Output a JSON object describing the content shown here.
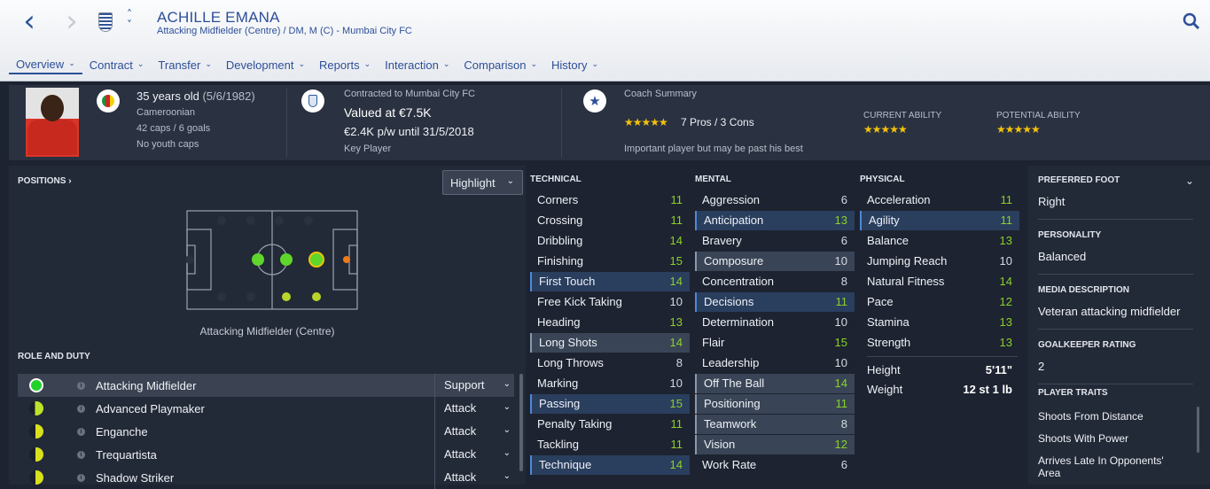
{
  "app": {
    "player_name": "ACHILLE EMANA",
    "player_subtitle": "Attacking Midfielder (Centre) / DM, M (C) - Mumbai City FC"
  },
  "tabs": [
    {
      "label": "Overview"
    },
    {
      "label": "Contract"
    },
    {
      "label": "Transfer"
    },
    {
      "label": "Development"
    },
    {
      "label": "Reports"
    },
    {
      "label": "Interaction"
    },
    {
      "label": "Comparison"
    },
    {
      "label": "History"
    }
  ],
  "header": {
    "age": "35 years old",
    "dob": "(5/6/1982)",
    "nationality": "Cameroonian",
    "caps": "42 caps / 6 goals",
    "youth_caps": "No youth caps",
    "contract_title": "Contracted to Mumbai City FC",
    "valued": "Valued at €7.5K",
    "wage": "€2.4K p/w until 31/5/2018",
    "status": "Key Player",
    "coach_title": "Coach Summary",
    "pros_cons": "7 Pros / 3 Cons",
    "coach_comment": "Important player but may be past his best",
    "ca_label": "CURRENT ABILITY",
    "pa_label": "POTENTIAL ABILITY",
    "ca_stars": 5,
    "pa_stars": 5,
    "star_color": "#f4c20d"
  },
  "positions": {
    "label": "POSITIONS",
    "highlight": "Highlight",
    "selected": "Attacking Midfielder (Centre)"
  },
  "roles": {
    "label": "ROLE AND DUTY",
    "items": [
      {
        "name": "Attacking Midfielder",
        "duty": "Support",
        "color": "#22d12a"
      },
      {
        "name": "Advanced Playmaker",
        "duty": "Attack",
        "color": "#bfe22a"
      },
      {
        "name": "Enganche",
        "duty": "Attack",
        "color": "#d8e01e"
      },
      {
        "name": "Trequartista",
        "duty": "Attack",
        "color": "#d8e01e"
      },
      {
        "name": "Shadow Striker",
        "duty": "Attack",
        "color": "#d8e01e"
      }
    ]
  },
  "technical": {
    "label": "TECHNICAL",
    "items": [
      {
        "name": "Corners",
        "value": "11"
      },
      {
        "name": "Crossing",
        "value": "11"
      },
      {
        "name": "Dribbling",
        "value": "14"
      },
      {
        "name": "Finishing",
        "value": "15"
      },
      {
        "name": "First Touch",
        "value": "14"
      },
      {
        "name": "Free Kick Taking",
        "value": "10"
      },
      {
        "name": "Heading",
        "value": "13"
      },
      {
        "name": "Long Shots",
        "value": "14"
      },
      {
        "name": "Long Throws",
        "value": "8"
      },
      {
        "name": "Marking",
        "value": "10"
      },
      {
        "name": "Passing",
        "value": "15"
      },
      {
        "name": "Penalty Taking",
        "value": "11"
      },
      {
        "name": "Tackling",
        "value": "11"
      },
      {
        "name": "Technique",
        "value": "14"
      }
    ]
  },
  "mental": {
    "label": "MENTAL",
    "items": [
      {
        "name": "Aggression",
        "value": "6"
      },
      {
        "name": "Anticipation",
        "value": "13"
      },
      {
        "name": "Bravery",
        "value": "6"
      },
      {
        "name": "Composure",
        "value": "10"
      },
      {
        "name": "Concentration",
        "value": "8"
      },
      {
        "name": "Decisions",
        "value": "11"
      },
      {
        "name": "Determination",
        "value": "10"
      },
      {
        "name": "Flair",
        "value": "15"
      },
      {
        "name": "Leadership",
        "value": "10"
      },
      {
        "name": "Off The Ball",
        "value": "14"
      },
      {
        "name": "Positioning",
        "value": "11"
      },
      {
        "name": "Teamwork",
        "value": "8"
      },
      {
        "name": "Vision",
        "value": "12"
      },
      {
        "name": "Work Rate",
        "value": "6"
      }
    ]
  },
  "physical": {
    "label": "PHYSICAL",
    "items": [
      {
        "name": "Acceleration",
        "value": "11"
      },
      {
        "name": "Agility",
        "value": "11"
      },
      {
        "name": "Balance",
        "value": "13"
      },
      {
        "name": "Jumping Reach",
        "value": "10"
      },
      {
        "name": "Natural Fitness",
        "value": "14"
      },
      {
        "name": "Pace",
        "value": "12"
      },
      {
        "name": "Stamina",
        "value": "13"
      },
      {
        "name": "Strength",
        "value": "13"
      }
    ],
    "height_label": "Height",
    "height": "5'11\"",
    "weight_label": "Weight",
    "weight": "12 st 1 lb"
  },
  "info": {
    "foot_label": "PREFERRED FOOT",
    "foot": "Right",
    "personality_label": "PERSONALITY",
    "personality": "Balanced",
    "media_label": "MEDIA DESCRIPTION",
    "media": "Veteran attacking midfielder",
    "gk_label": "GOALKEEPER RATING",
    "gk": "2",
    "traits_label": "PLAYER TRAITS",
    "traits": [
      "Shoots From Distance",
      "Shoots With Power",
      "Arrives Late In Opponents' Area"
    ]
  },
  "colors": {
    "accent": "#2d4f98",
    "good_value": "#8bd12a",
    "highlight_row": "#2a3e5e"
  }
}
